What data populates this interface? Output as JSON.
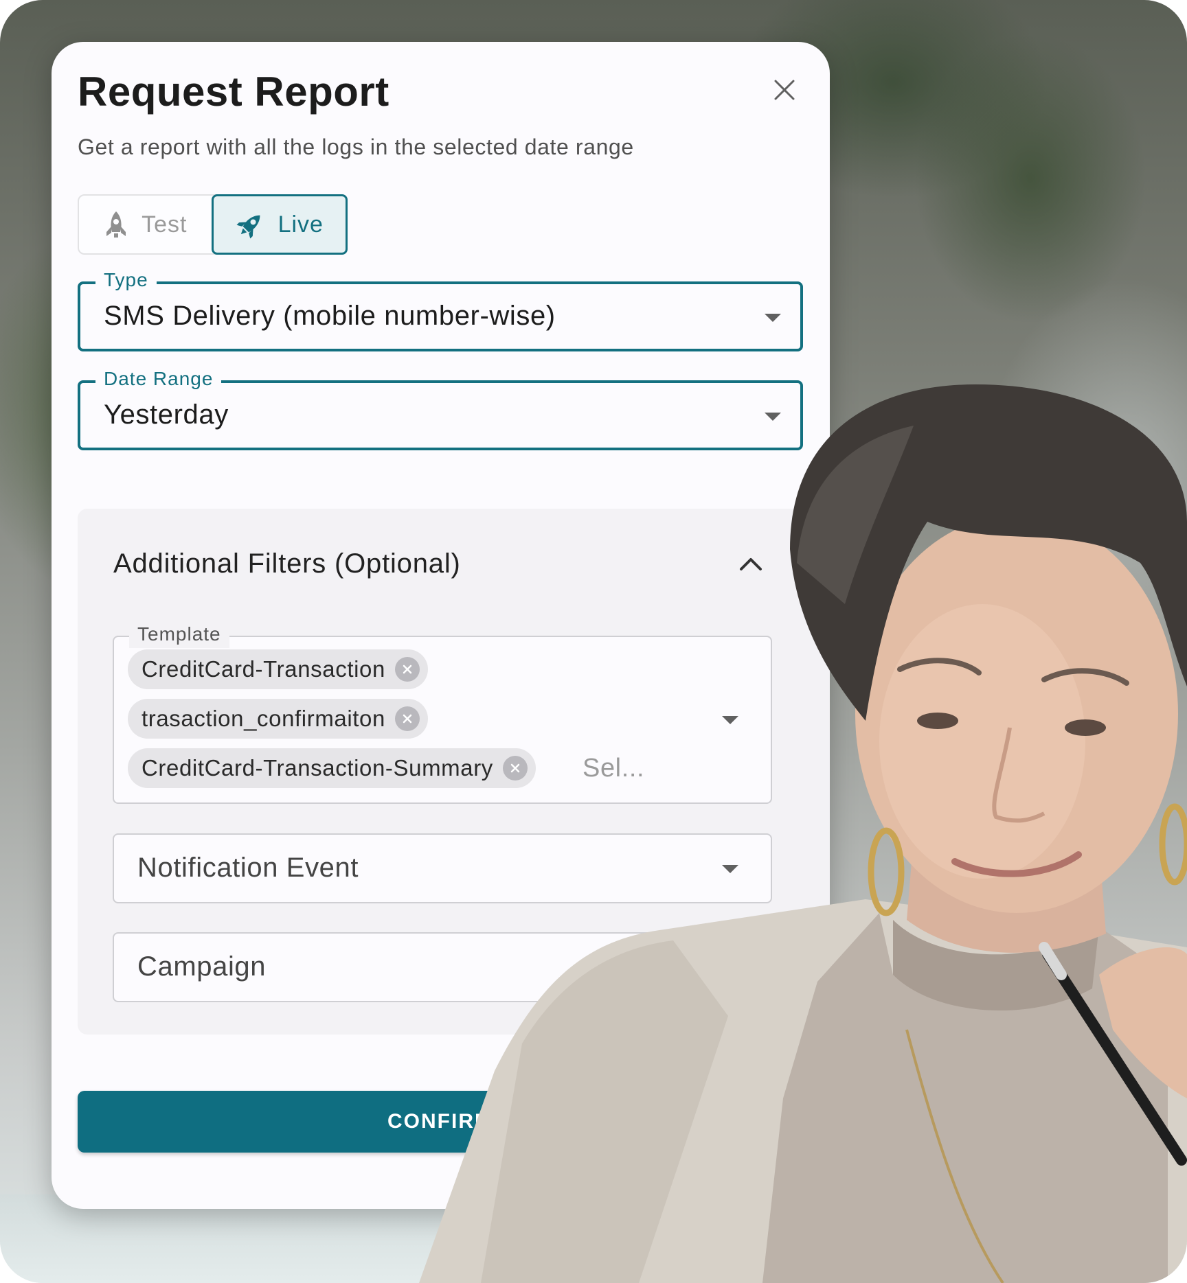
{
  "dialog": {
    "title": "Request Report",
    "subtitle": "Get a report with all the logs in the selected date range",
    "close_icon": "close-icon"
  },
  "mode_toggle": {
    "options": [
      {
        "label": "Test",
        "icon": "rocket-icon",
        "selected": false
      },
      {
        "label": "Live",
        "icon": "rocket-launch-icon",
        "selected": true
      }
    ]
  },
  "type_field": {
    "label": "Type",
    "value": "SMS Delivery (mobile number-wise)"
  },
  "date_range_field": {
    "label": "Date Range",
    "value": "Yesterday"
  },
  "additional_filters": {
    "title": "Additional Filters (Optional)",
    "expanded": true,
    "template": {
      "label": "Template",
      "chips": [
        "CreditCard-Transaction",
        "trasaction_confirmaiton",
        "CreditCard-Transaction-Summary"
      ],
      "placeholder": "Sel..."
    },
    "notification_event": {
      "placeholder": "Notification Event"
    },
    "campaign": {
      "placeholder": "Campaign"
    }
  },
  "confirm_button": {
    "label": "CONFIRM"
  },
  "colors": {
    "accent": "#137080",
    "confirm_bg": "#0f6e81",
    "panel_bg": "#f3f2f5"
  }
}
